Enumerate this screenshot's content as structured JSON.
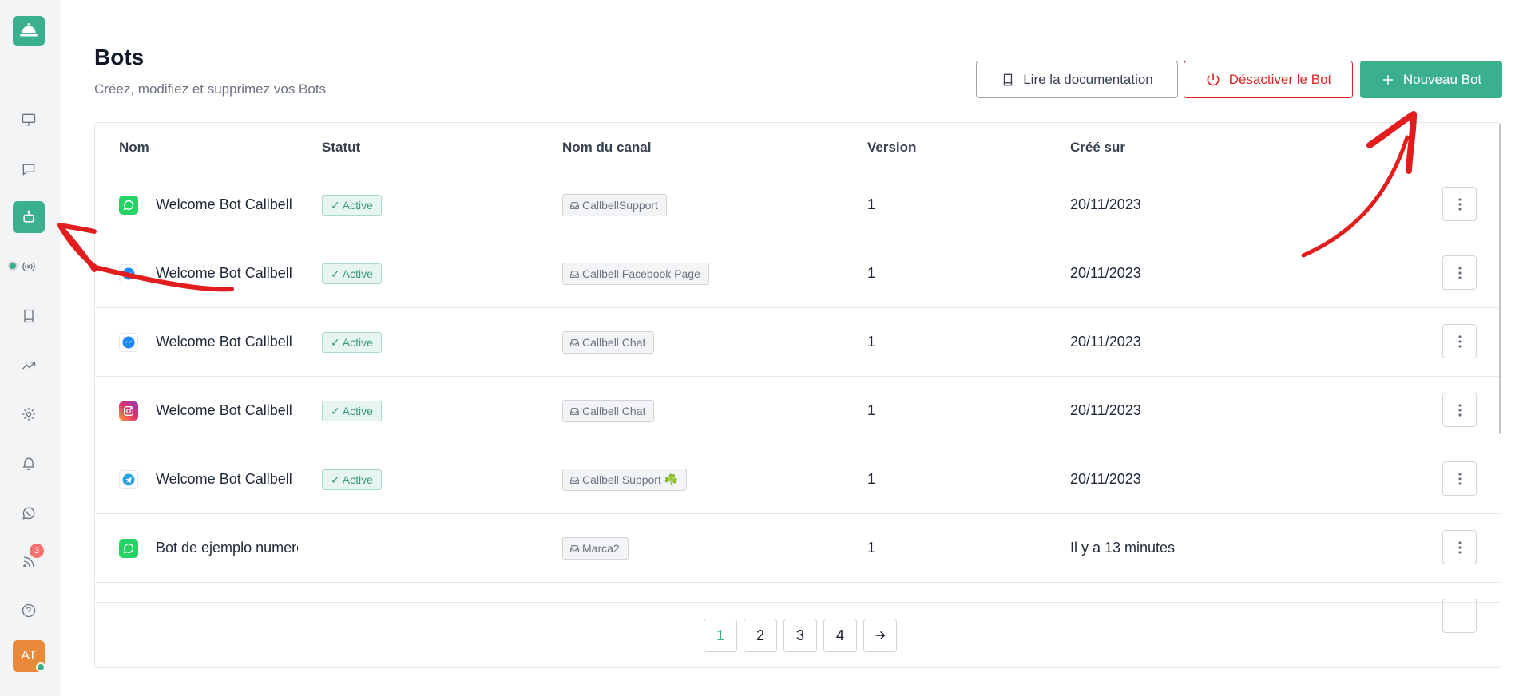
{
  "sidebar": {
    "logo_icon": "service-bell-icon",
    "items": [
      {
        "icon": "monitor-icon"
      },
      {
        "icon": "chat-bubble-icon"
      },
      {
        "icon": "robot-icon",
        "active": true
      },
      {
        "icon": "broadcast-icon"
      },
      {
        "icon": "book-icon"
      },
      {
        "icon": "trending-up-icon"
      },
      {
        "icon": "gear-icon"
      },
      {
        "icon": "bell-icon"
      },
      {
        "icon": "whatsapp-icon"
      },
      {
        "icon": "rss-icon",
        "badge": "3"
      },
      {
        "icon": "help-circle-icon"
      }
    ],
    "avatar_initials": "AT",
    "accent": "#3bb08f"
  },
  "header": {
    "title": "Bots",
    "subtitle": "Créez, modifiez et supprimez vos Bots",
    "doc_button": "Lire la documentation",
    "deactivate_button": "Désactiver le Bot",
    "new_button": "Nouveau Bot"
  },
  "table": {
    "columns": [
      "Nom",
      "Statut",
      "Nom du canal",
      "Version",
      "Créé sur"
    ],
    "rows": [
      {
        "channel_icon": "whatsapp-icon",
        "name": "Welcome Bot Callbell",
        "status": "Active",
        "channel": "CallbellSupport",
        "version": "1",
        "created": "20/11/2023"
      },
      {
        "channel_icon": "messenger-icon",
        "name": "Welcome Bot Callbell",
        "status": "Active",
        "channel": "Callbell Facebook Page",
        "version": "1",
        "created": "20/11/2023"
      },
      {
        "channel_icon": "messenger-icon",
        "name": "Welcome Bot Callbell",
        "status": "Active",
        "channel": "Callbell Chat",
        "version": "1",
        "created": "20/11/2023"
      },
      {
        "channel_icon": "instagram-icon",
        "name": "Welcome Bot Callbell",
        "status": "Active",
        "channel": "Callbell Chat",
        "version": "1",
        "created": "20/11/2023"
      },
      {
        "channel_icon": "telegram-icon",
        "name": "Welcome Bot Callbell",
        "status": "Active",
        "channel": "Callbell Support ☘️",
        "version": "1",
        "created": "20/11/2023"
      },
      {
        "channel_icon": "whatsapp-icon",
        "name": "Bot de ejemplo numero",
        "status": "",
        "channel": "Marca2",
        "version": "1",
        "created": "Il y a 13 minutes"
      }
    ]
  },
  "pagination": {
    "pages": [
      "1",
      "2",
      "3",
      "4"
    ],
    "current": "1",
    "next_icon": "arrow-right-icon"
  },
  "colors": {
    "accent": "#3bb08f",
    "danger": "#dc2626",
    "annotation": "#e11d1d"
  }
}
